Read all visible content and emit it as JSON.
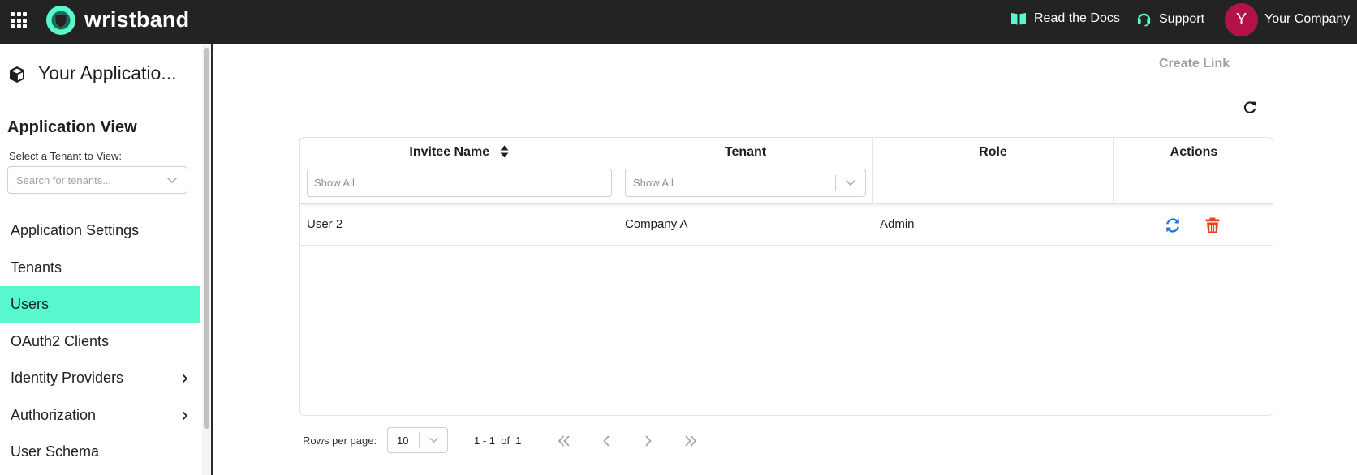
{
  "header": {
    "logo_text": "wristband",
    "docs_label": "Read the Docs",
    "support_label": "Support",
    "avatar_initial": "Y",
    "company_name": "Your Company",
    "accent_color": "#58f7cd",
    "avatar_color": "#b5124a"
  },
  "sidebar": {
    "app_title": "Your Applicatio...",
    "view_title": "Application View",
    "tenant_label": "Select a Tenant to View:",
    "tenant_placeholder": "Search for tenants...",
    "items": [
      {
        "label": "Application Settings",
        "active": false,
        "has_children": false
      },
      {
        "label": "Tenants",
        "active": false,
        "has_children": false
      },
      {
        "label": "Users",
        "active": true,
        "has_children": false
      },
      {
        "label": "OAuth2 Clients",
        "active": false,
        "has_children": false
      },
      {
        "label": "Identity Providers",
        "active": false,
        "has_children": true
      },
      {
        "label": "Authorization",
        "active": false,
        "has_children": true
      },
      {
        "label": "User Schema",
        "active": false,
        "has_children": false
      }
    ]
  },
  "main": {
    "create_link_label": "Create Link",
    "table": {
      "columns": [
        {
          "label": "Invitee Name",
          "filter_placeholder": "Show All",
          "sortable": true
        },
        {
          "label": "Tenant",
          "filter_placeholder": "Show All"
        },
        {
          "label": "Role"
        },
        {
          "label": "Actions"
        }
      ],
      "rows": [
        {
          "invitee_name": "User 2",
          "tenant": "Company A",
          "role": "Admin"
        }
      ],
      "resend_color": "#1a73e8",
      "delete_color": "#e8421c"
    },
    "pagination": {
      "rows_per_page_label": "Rows per page:",
      "rows_per_page_value": "10",
      "range_text": "1 - 1  of  1"
    }
  }
}
